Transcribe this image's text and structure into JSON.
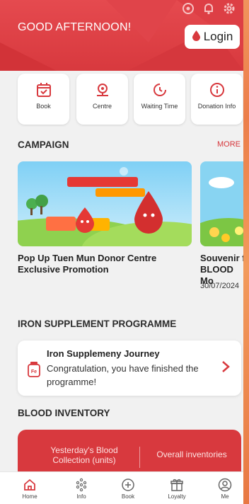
{
  "header": {
    "greeting": "GOOD AFTERNOON!",
    "login_label": "Login",
    "status_icons": [
      "location-icon",
      "bell-icon",
      "gear-icon"
    ]
  },
  "quick_actions": [
    {
      "label": "Book",
      "icon": "calendar-check-icon"
    },
    {
      "label": "Centre",
      "icon": "location-pin-icon"
    },
    {
      "label": "Waiting Time",
      "icon": "clock-icon"
    },
    {
      "label": "Donation Info",
      "icon": "info-icon"
    }
  ],
  "campaign": {
    "title": "CAMPAIGN",
    "more_label": "MORE",
    "items": [
      {
        "title": "Pop Up Tuen Mun Donor Centre Exclusive Promotion",
        "date": ""
      },
      {
        "title": "Souvenir f BLOOD Mo",
        "date": "30/07/2024"
      }
    ]
  },
  "iron": {
    "section_title": "IRON SUPPLEMENT PROGRAMME",
    "card_title": "Iron Supplemeny Journey",
    "card_text": "Congratulation, you have finished the programme!",
    "badge": "Fe"
  },
  "inventory": {
    "section_title": "BLOOD INVENTORY",
    "col1": "Yesterday's Blood Collection (units)",
    "col2": "Overall inventories"
  },
  "tabs": [
    {
      "label": "Home",
      "icon": "home-icon"
    },
    {
      "label": "Info",
      "icon": "dots-grid-icon"
    },
    {
      "label": "Book",
      "icon": "plus-circle-icon"
    },
    {
      "label": "Loyalty",
      "icon": "gift-icon"
    },
    {
      "label": "Me",
      "icon": "user-icon"
    }
  ],
  "colors": {
    "brand": "#d8393e",
    "accent": "#e54a4f"
  }
}
